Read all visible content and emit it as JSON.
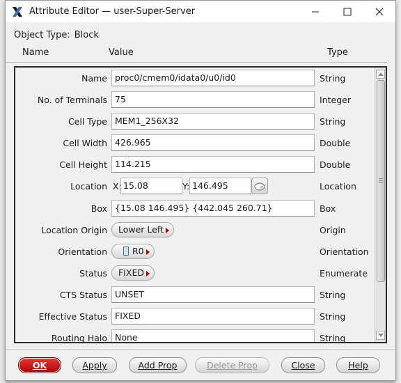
{
  "window": {
    "title": "Attribute Editor — user-Super-Server",
    "controls": [
      "minimize",
      "maximize",
      "close"
    ]
  },
  "object_type": {
    "label": "Object Type:",
    "value": "Block"
  },
  "columns": {
    "name": "Name",
    "value": "Value",
    "type": "Type"
  },
  "rows": [
    {
      "name": "Name",
      "value": "proc0/cmem0/idata0/u0/id0",
      "type": "String"
    },
    {
      "name": "No. of Terminals",
      "value": "75",
      "type": "Integer"
    },
    {
      "name": "Cell Type",
      "value": "MEM1_256X32",
      "type": "String"
    },
    {
      "name": "Cell Width",
      "value": "426.965",
      "type": "Double"
    },
    {
      "name": "Cell Height",
      "value": "114.215",
      "type": "Double"
    },
    {
      "name": "Location",
      "x_label": "X:",
      "x_value": "15.08",
      "y_label": "Y:",
      "y_value": "146.495",
      "type": "Location"
    },
    {
      "name": "Box",
      "value": "{15.08 146.495} {442.045 260.71}",
      "type": "Box"
    },
    {
      "name": "Location Origin",
      "value": "Lower Left",
      "type": "Origin"
    },
    {
      "name": "Orientation",
      "value": "R0",
      "type": "Orientation"
    },
    {
      "name": "Status",
      "value": "FIXED",
      "type": "Enumerate"
    },
    {
      "name": "CTS Status",
      "value": "UNSET",
      "type": "String"
    },
    {
      "name": "Effective Status",
      "value": "FIXED",
      "type": "String"
    },
    {
      "name": "Routing Halo",
      "value": "None",
      "type": "String"
    }
  ],
  "buttons": {
    "ok": "OK",
    "apply": "Apply",
    "add_prop": "Add Prop",
    "delete_prop": "Delete Prop",
    "close": "Close",
    "help": "Help"
  },
  "colors": {
    "ok_button": "#cc0000",
    "title_bar": "#ffffff",
    "dialog_bg": "#f0f0f0"
  },
  "scrollbar": {
    "position_fraction": 0.0
  }
}
